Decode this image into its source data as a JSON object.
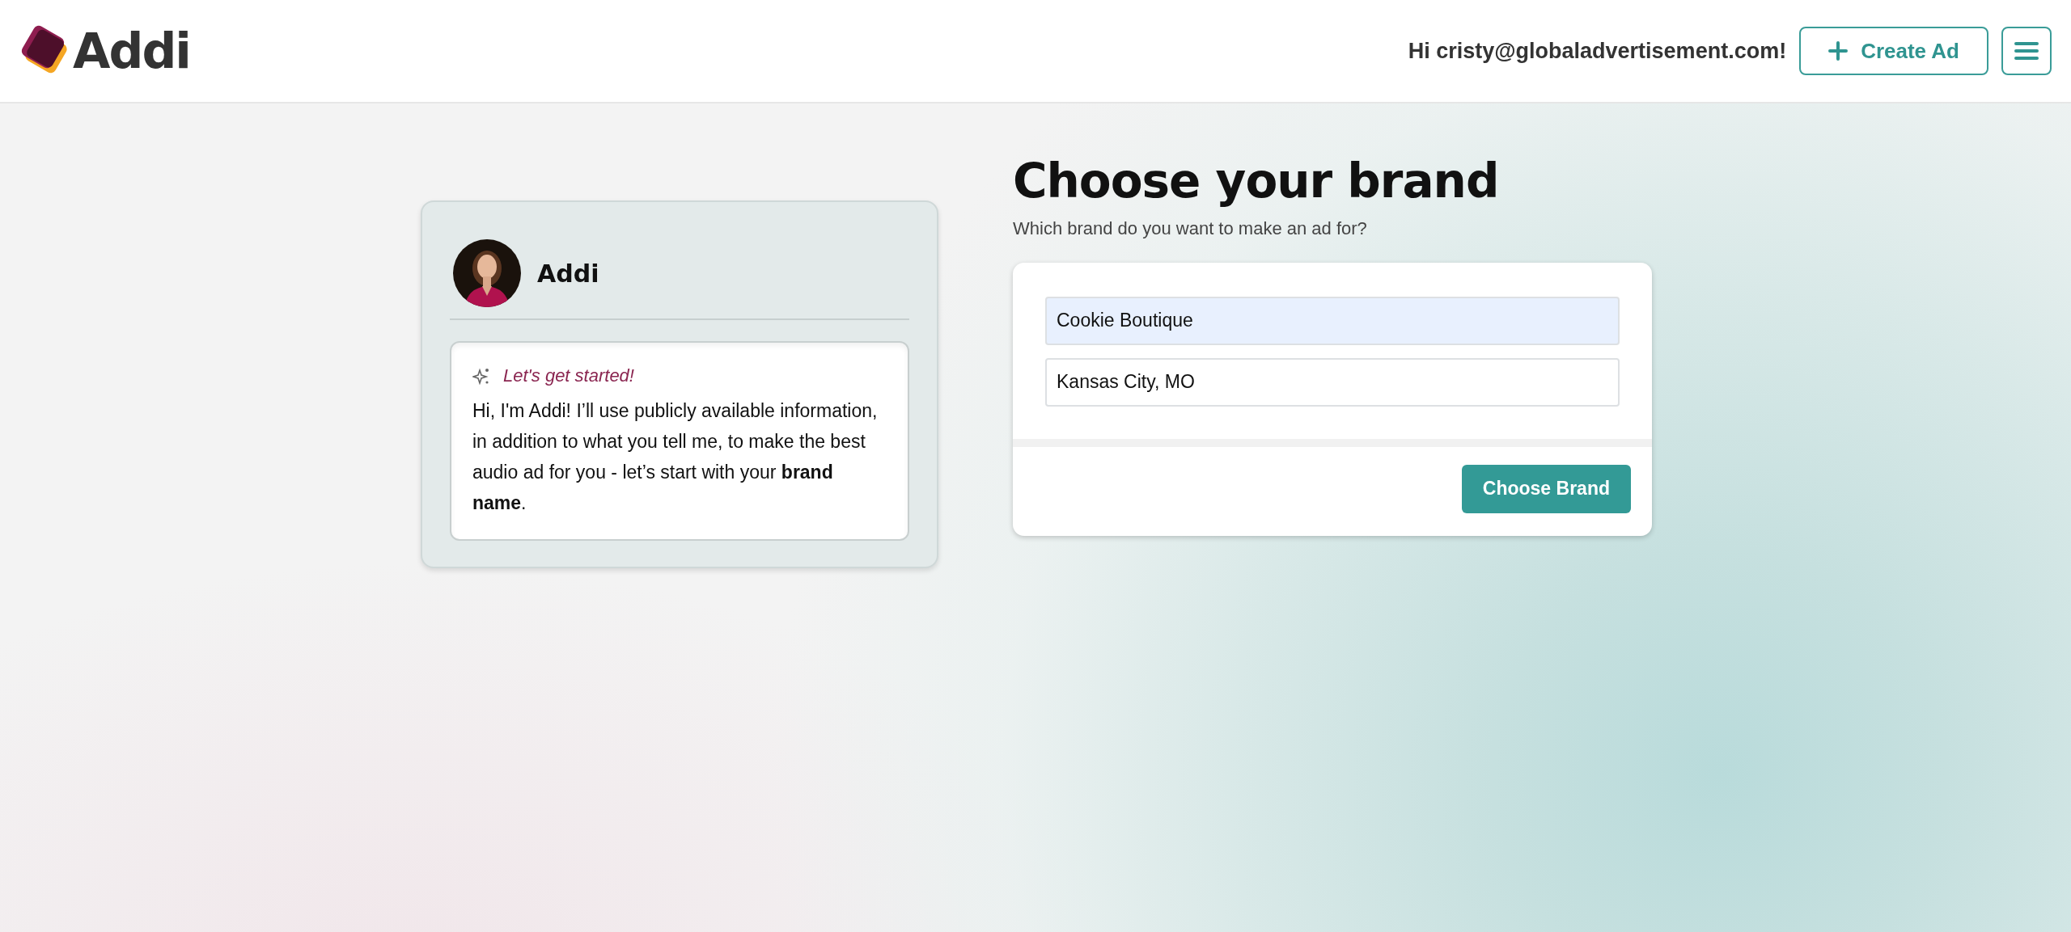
{
  "header": {
    "logo_text": "Addi",
    "greeting": "Hi cristy@globaladvertisement.com!",
    "create_button": "Create Ad"
  },
  "assistant": {
    "name": "Addi",
    "message": {
      "heading": "Let's get started!",
      "body": "Hi, I'm Addi! I’ll use publicly available information, in addition to what you tell me, to make the best audio ad for you - let’s start with your **brand name**."
    }
  },
  "page": {
    "title": "Choose your brand",
    "subtitle": "Which brand do you want to make an ad for?"
  },
  "form": {
    "fields": [
      {
        "value": "Cookie Boutique",
        "autofilled": true
      },
      {
        "value": "Kansas City, MO",
        "autofilled": false
      }
    ],
    "submit": "Choose Brand"
  }
}
